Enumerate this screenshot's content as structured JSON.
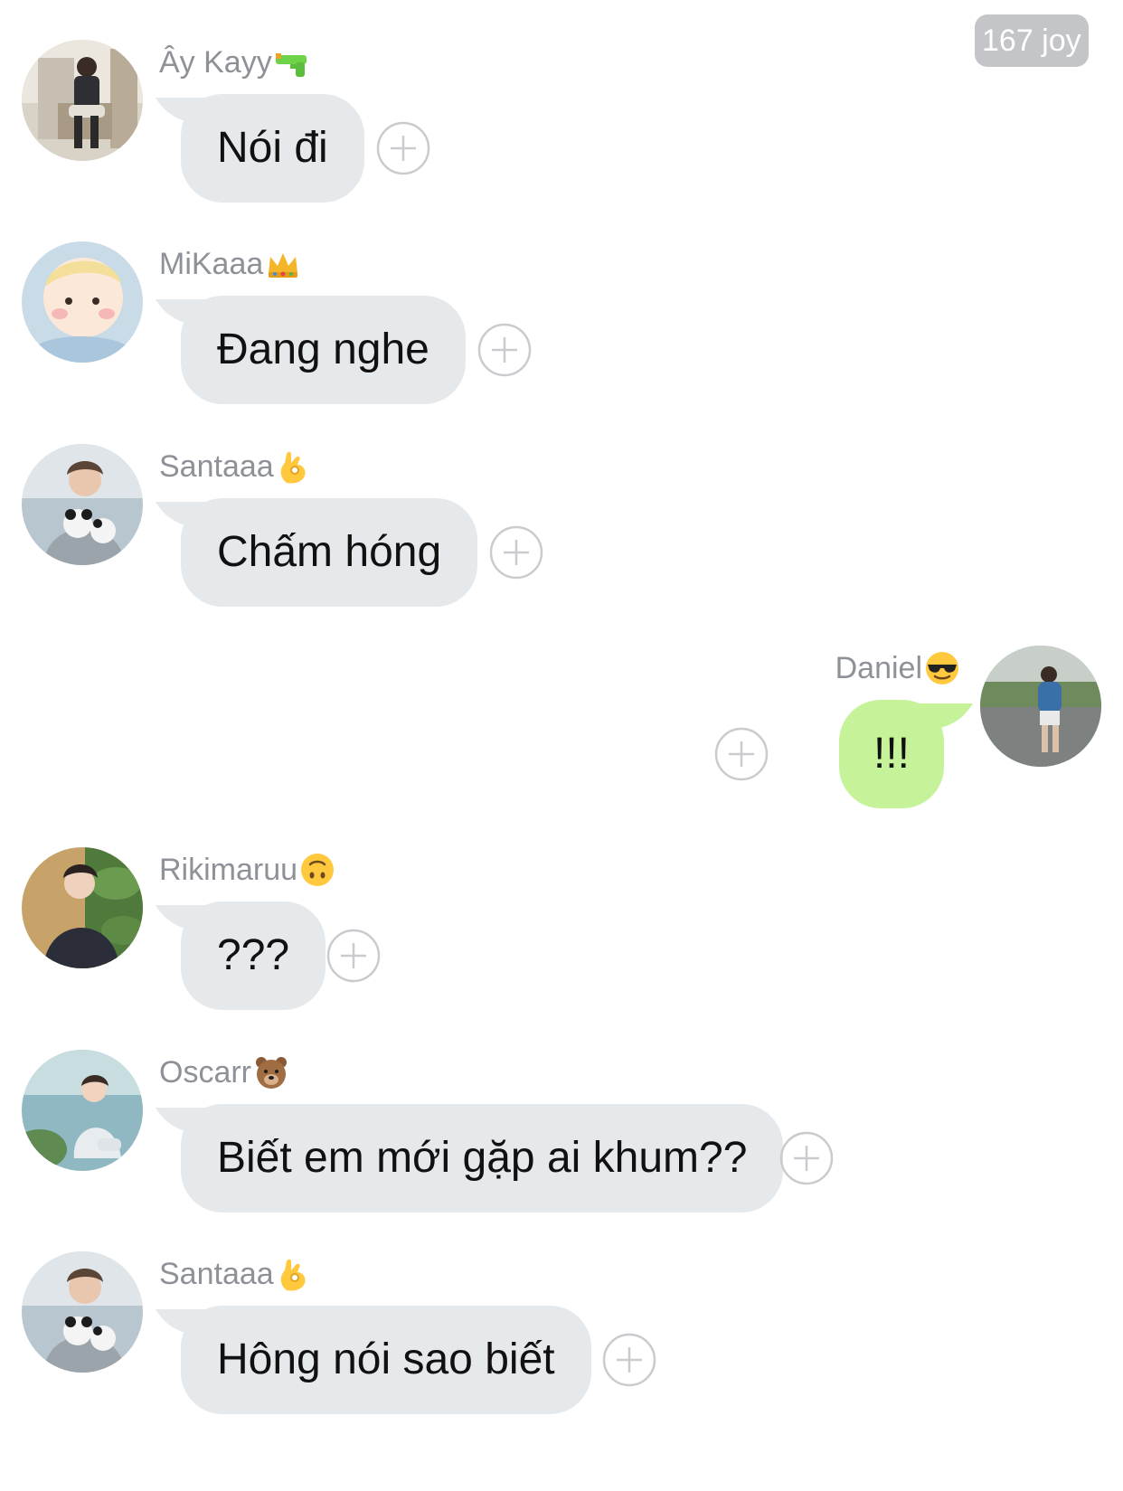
{
  "counter": {
    "label": "167 joy"
  },
  "messages": [
    {
      "sender": "Ây Kayy",
      "sender_emoji": "water-pistol-icon",
      "text": "Nói đi",
      "side": "left"
    },
    {
      "sender": "MiKaaa",
      "sender_emoji": "crown-icon",
      "text": "Đang nghe",
      "side": "left"
    },
    {
      "sender": "Santaaa",
      "sender_emoji": "ok-hand-icon",
      "text": "Chấm hóng",
      "side": "left"
    },
    {
      "sender": "Daniel",
      "sender_emoji": "sunglasses-face-icon",
      "text": "!!!",
      "side": "right"
    },
    {
      "sender": "Rikimaruu",
      "sender_emoji": "upside-down-face-icon",
      "text": "???",
      "side": "left"
    },
    {
      "sender": "Oscarr",
      "sender_emoji": "bear-face-icon",
      "text": "Biết em mới gặp ai khum??",
      "side": "left"
    },
    {
      "sender": "Santaaa",
      "sender_emoji": "ok-hand-icon",
      "text": "Hông nói sao biết",
      "side": "left"
    }
  ],
  "colors": {
    "bubble_other": "#e6e9ec",
    "bubble_mine": "#c6f29a",
    "name_text": "#8e9197",
    "counter_bg": "#c3c5c8",
    "plus_outline": "#c9cbcf"
  }
}
